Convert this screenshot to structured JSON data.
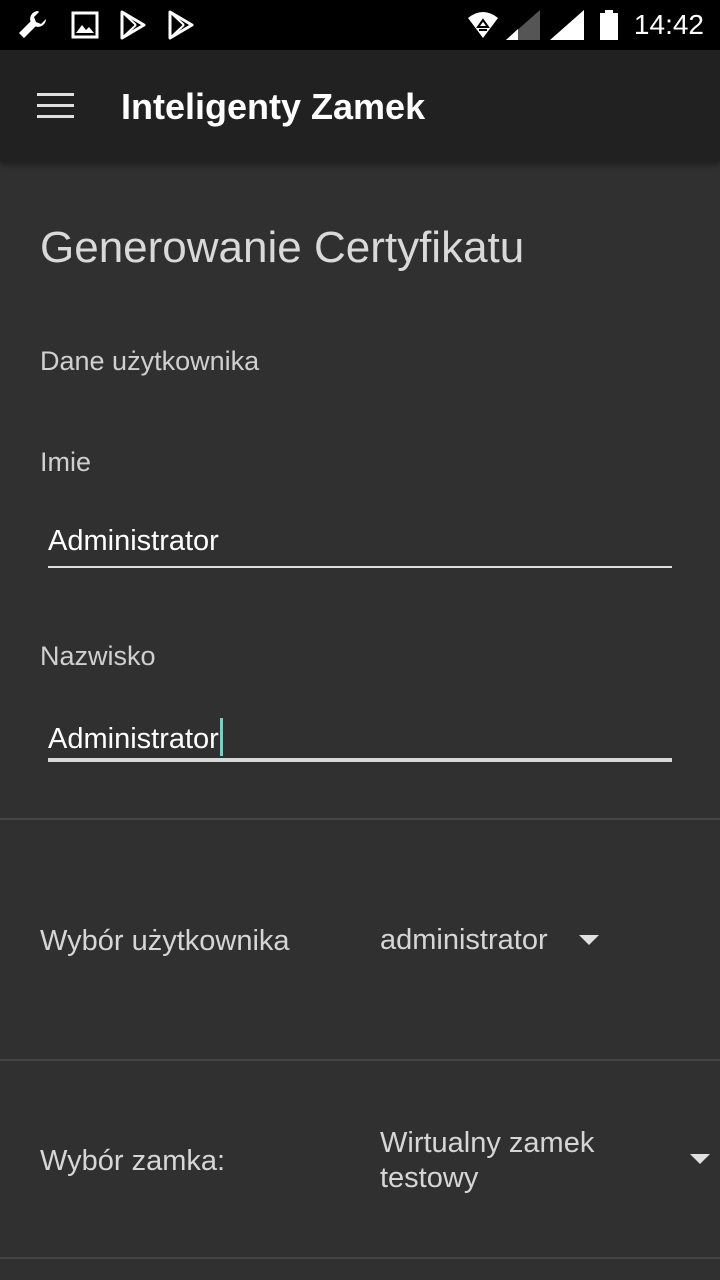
{
  "status_bar": {
    "time": "14:42",
    "icons": [
      "wrench-icon",
      "image-icon",
      "play-store-icon",
      "play-store-icon",
      "wifi-icon",
      "signal-icon",
      "signal-icon",
      "battery-icon"
    ]
  },
  "app_bar": {
    "title": "Inteligenty Zamek",
    "menu_icon": "hamburger-menu-icon"
  },
  "page": {
    "title": "Generowanie Certyfikatu",
    "section_label": "Dane użytkownika",
    "first_name_label": "Imie",
    "first_name_value": "Administrator",
    "last_name_label": "Nazwisko",
    "last_name_value": "Administrator",
    "user_select_label": "Wybór użytkownika",
    "user_select_value": "administrator",
    "lock_select_label": "Wybór zamka:",
    "lock_select_value": "Wirtualny zamek testowy"
  },
  "colors": {
    "background": "#303030",
    "app_bar": "#212121",
    "cursor": "#80cbc4"
  }
}
